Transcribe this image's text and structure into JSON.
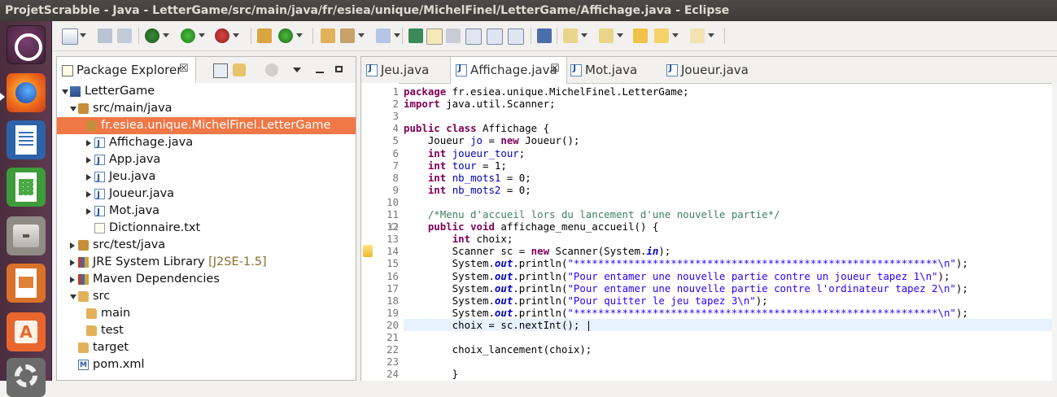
{
  "window": {
    "title": "ProjetScrabble - Java - LetterGame/src/main/java/fr/esiea/unique/MichelFinel/LetterGame/Affichage.java - Eclipse"
  },
  "launcher": {
    "apps": [
      "ubuntu-dash",
      "firefox",
      "libreoffice-writer",
      "libreoffice-calc",
      "files",
      "libreoffice-impress",
      "software-center",
      "system-settings"
    ]
  },
  "package_explorer": {
    "tab_label": "Package Explorer",
    "close": "☒",
    "tree": [
      {
        "label": "LetterGame",
        "deco": "",
        "indent": 0,
        "toggle": "open",
        "icon": "proj"
      },
      {
        "label": "src/main/java",
        "deco": "",
        "indent": 1,
        "toggle": "open",
        "icon": "pkg"
      },
      {
        "label": "fr.esiea.unique.MichelFinel.LetterGame",
        "deco": "",
        "indent": 2,
        "toggle": "none",
        "icon": "pkg",
        "selected": true
      },
      {
        "label": "Affichage.java",
        "deco": "",
        "indent": 3,
        "toggle": "closed",
        "icon": "java"
      },
      {
        "label": "App.java",
        "deco": "",
        "indent": 3,
        "toggle": "closed",
        "icon": "java"
      },
      {
        "label": "Jeu.java",
        "deco": "",
        "indent": 3,
        "toggle": "closed",
        "icon": "java"
      },
      {
        "label": "Joueur.java",
        "deco": "",
        "indent": 3,
        "toggle": "closed",
        "icon": "java"
      },
      {
        "label": "Mot.java",
        "deco": "",
        "indent": 3,
        "toggle": "closed",
        "icon": "java"
      },
      {
        "label": "Dictionnaire.txt",
        "deco": "",
        "indent": 3,
        "toggle": "none",
        "icon": "txt"
      },
      {
        "label": "src/test/java",
        "deco": "",
        "indent": 1,
        "toggle": "closed",
        "icon": "pkg"
      },
      {
        "label": "JRE System Library ",
        "deco": "[J2SE-1.5]",
        "indent": 1,
        "toggle": "closed",
        "icon": "lib"
      },
      {
        "label": "Maven Dependencies",
        "deco": "",
        "indent": 1,
        "toggle": "closed",
        "icon": "lib"
      },
      {
        "label": "src",
        "deco": "",
        "indent": 1,
        "toggle": "open",
        "icon": "folder"
      },
      {
        "label": "main",
        "deco": "",
        "indent": 2,
        "toggle": "none",
        "icon": "folder"
      },
      {
        "label": "test",
        "deco": "",
        "indent": 2,
        "toggle": "none",
        "icon": "folder"
      },
      {
        "label": "target",
        "deco": "",
        "indent": 1,
        "toggle": "none",
        "icon": "folder"
      },
      {
        "label": "pom.xml",
        "deco": "",
        "indent": 1,
        "toggle": "none",
        "icon": "xml"
      }
    ]
  },
  "editor": {
    "tabs": [
      {
        "label": "Jeu.java",
        "active": false
      },
      {
        "label": "Affichage.java",
        "active": true,
        "close": "☒"
      },
      {
        "label": "Mot.java",
        "active": false
      },
      {
        "label": "Joueur.java",
        "active": false
      }
    ],
    "current_line": 20,
    "lines": [
      {
        "n": "1",
        "tokens": [
          [
            "k",
            "package"
          ],
          [
            "t",
            " fr.esiea.unique.MichelFinel.LetterGame;"
          ]
        ]
      },
      {
        "n": "2",
        "tokens": [
          [
            "k",
            "import"
          ],
          [
            "t",
            " java.util.Scanner;"
          ]
        ]
      },
      {
        "n": "3",
        "tokens": []
      },
      {
        "n": "4",
        "tokens": [
          [
            "k",
            "public"
          ],
          [
            "t",
            " "
          ],
          [
            "k",
            "class"
          ],
          [
            "t",
            " Affichage {"
          ]
        ]
      },
      {
        "n": "5",
        "tokens": [
          [
            "t",
            "    Joueur "
          ],
          [
            "f",
            "jo"
          ],
          [
            "t",
            " = "
          ],
          [
            "k",
            "new"
          ],
          [
            "t",
            " Joueur();"
          ]
        ]
      },
      {
        "n": "6",
        "tokens": [
          [
            "t",
            "    "
          ],
          [
            "k",
            "int"
          ],
          [
            "t",
            " "
          ],
          [
            "f",
            "joueur_tour"
          ],
          [
            "t",
            ";"
          ]
        ]
      },
      {
        "n": "7",
        "tokens": [
          [
            "t",
            "    "
          ],
          [
            "k",
            "int"
          ],
          [
            "t",
            " "
          ],
          [
            "f",
            "tour"
          ],
          [
            "t",
            " = 1;"
          ]
        ]
      },
      {
        "n": "8",
        "tokens": [
          [
            "t",
            "    "
          ],
          [
            "k",
            "int"
          ],
          [
            "t",
            " "
          ],
          [
            "f",
            "nb_mots1"
          ],
          [
            "t",
            " = 0;"
          ]
        ]
      },
      {
        "n": "9",
        "tokens": [
          [
            "t",
            "    "
          ],
          [
            "k",
            "int"
          ],
          [
            "t",
            " "
          ],
          [
            "f",
            "nb_mots2"
          ],
          [
            "t",
            " = 0;"
          ]
        ]
      },
      {
        "n": "10",
        "tokens": []
      },
      {
        "n": "11",
        "tokens": [
          [
            "t",
            "    "
          ],
          [
            "c",
            "/*Menu d'accueil lors du lancement d'une nouvelle partie*/"
          ]
        ]
      },
      {
        "n": "12",
        "fold": true,
        "tokens": [
          [
            "t",
            "    "
          ],
          [
            "k",
            "public"
          ],
          [
            "t",
            " "
          ],
          [
            "k",
            "void"
          ],
          [
            "t",
            " affichage_menu_accueil() {"
          ]
        ]
      },
      {
        "n": "13",
        "tokens": [
          [
            "t",
            "        "
          ],
          [
            "k",
            "int"
          ],
          [
            "t",
            " choix;"
          ]
        ]
      },
      {
        "n": "14",
        "warn": true,
        "tokens": [
          [
            "t",
            "        Scanner sc = "
          ],
          [
            "k",
            "new"
          ],
          [
            "t",
            " Scanner(System."
          ],
          [
            "st",
            "in"
          ],
          [
            "t",
            ");"
          ]
        ]
      },
      {
        "n": "15",
        "tokens": [
          [
            "t",
            "        System."
          ],
          [
            "st",
            "out"
          ],
          [
            "t",
            ".println("
          ],
          [
            "s",
            "\"************************************************************\\n\""
          ],
          [
            "t",
            ");"
          ]
        ]
      },
      {
        "n": "16",
        "tokens": [
          [
            "t",
            "        System."
          ],
          [
            "st",
            "out"
          ],
          [
            "t",
            ".println("
          ],
          [
            "s",
            "\"Pour entamer une nouvelle partie contre un joueur tapez 1\\n\""
          ],
          [
            "t",
            ");"
          ]
        ]
      },
      {
        "n": "17",
        "tokens": [
          [
            "t",
            "        System."
          ],
          [
            "st",
            "out"
          ],
          [
            "t",
            ".println("
          ],
          [
            "s",
            "\"Pour entamer une nouvelle partie contre l'ordinateur tapez 2\\n\""
          ],
          [
            "t",
            ");"
          ]
        ]
      },
      {
        "n": "18",
        "tokens": [
          [
            "t",
            "        System."
          ],
          [
            "st",
            "out"
          ],
          [
            "t",
            ".println("
          ],
          [
            "s",
            "\"Pour quitter le jeu tapez 3\\n\""
          ],
          [
            "t",
            ");"
          ]
        ]
      },
      {
        "n": "19",
        "tokens": [
          [
            "t",
            "        System."
          ],
          [
            "st",
            "out"
          ],
          [
            "t",
            ".println("
          ],
          [
            "s",
            "\"************************************************************\\n\""
          ],
          [
            "t",
            ");"
          ]
        ]
      },
      {
        "n": "20",
        "tokens": [
          [
            "t",
            "        choix = sc.nextInt(); |"
          ]
        ]
      },
      {
        "n": "21",
        "tokens": []
      },
      {
        "n": "22",
        "tokens": [
          [
            "t",
            "        choix_lancement(choix);"
          ]
        ]
      },
      {
        "n": "23",
        "tokens": []
      },
      {
        "n": "24",
        "tokens": [
          [
            "t",
            "        }"
          ]
        ]
      }
    ]
  }
}
